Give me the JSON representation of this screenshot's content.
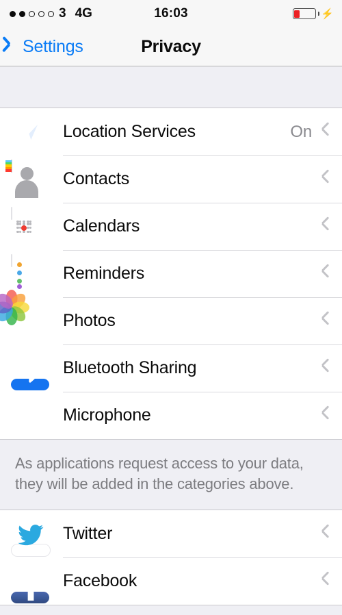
{
  "status_bar": {
    "signal_dots_filled": 2,
    "signal_dots_total": 5,
    "carrier": "3",
    "network": "4G",
    "time": "16:03",
    "battery_percent": 25,
    "battery_color": "#ec2024",
    "charging": true,
    "charging_icon": "lightning-bolt-icon"
  },
  "nav_bar": {
    "back_label": "Settings",
    "back_icon": "chevron-left-icon",
    "title": "Privacy",
    "tint_color": "#0b7cf6"
  },
  "sections": [
    {
      "rows": [
        {
          "label": "Location Services",
          "value": "On",
          "icon": "location-arrow-icon",
          "accessory": "chevron-right-icon"
        },
        {
          "label": "Contacts",
          "value": "",
          "icon": "contacts-icon",
          "accessory": "chevron-right-icon"
        },
        {
          "label": "Calendars",
          "value": "",
          "icon": "calendar-icon",
          "accessory": "chevron-right-icon"
        },
        {
          "label": "Reminders",
          "value": "",
          "icon": "reminders-icon",
          "accessory": "chevron-right-icon"
        },
        {
          "label": "Photos",
          "value": "",
          "icon": "photos-icon",
          "accessory": "chevron-right-icon"
        },
        {
          "label": "Bluetooth Sharing",
          "value": "",
          "icon": "bluetooth-icon",
          "accessory": "chevron-right-icon"
        },
        {
          "label": "Microphone",
          "value": "",
          "icon": "microphone-icon",
          "accessory": "chevron-right-icon"
        }
      ],
      "footer": "As applications request access to your data, they will be added in the categories above."
    },
    {
      "rows": [
        {
          "label": "Twitter",
          "value": "",
          "icon": "twitter-icon",
          "accessory": "chevron-right-icon"
        },
        {
          "label": "Facebook",
          "value": "",
          "icon": "facebook-icon",
          "accessory": "chevron-right-icon"
        }
      ],
      "footer": ""
    }
  ],
  "colors": {
    "background": "#efeff4",
    "row_background": "#ffffff",
    "separator": "#d9d9dd",
    "label": "#0b0b0b",
    "value": "#8a8a8f",
    "chevron": "#c3c3c7",
    "footer_text": "#7c7c80",
    "location_icon_bg": "#1574f0",
    "calendar_red": "#ee3b30",
    "microphone_red": "#f3413b",
    "bluetooth_blue": "#1574f0",
    "twitter_blue": "#29a9e1",
    "facebook_blue": "#3b5998"
  }
}
